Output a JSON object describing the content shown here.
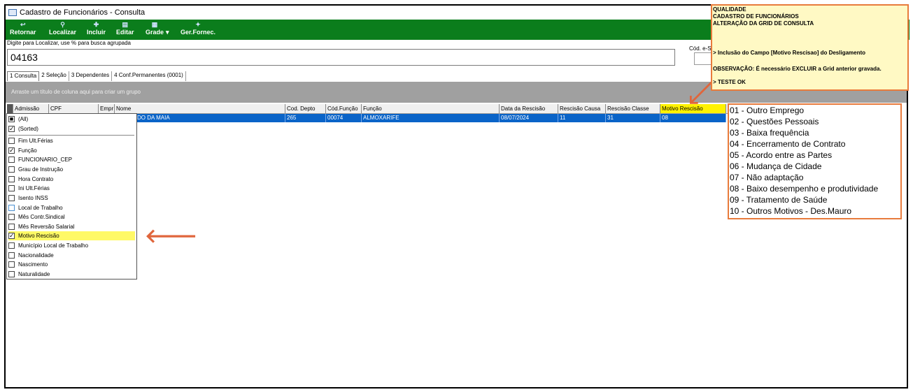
{
  "window": {
    "title": "Cadastro de Funcionários - Consulta"
  },
  "toolbar": {
    "buttons": [
      {
        "label": "Retornar",
        "icon": "return-icon"
      },
      {
        "label": "Localizar",
        "icon": "search-icon"
      },
      {
        "label": "Incluir",
        "icon": "add-icon"
      },
      {
        "label": "Editar",
        "icon": "edit-icon"
      },
      {
        "label": "Grade",
        "icon": "grid-icon"
      },
      {
        "label": "Ger.Fornec.",
        "icon": "supplier-icon"
      }
    ],
    "bg_color": "#0b7d1c"
  },
  "search": {
    "label": "Digite para Localizar, use % para busca agrupada",
    "value": "04163",
    "cod_label": "Cód. e-S"
  },
  "tabs": [
    "1 Consulta",
    "2 Seleção",
    "3 Dependentes",
    "4 Conf.Permanentes (0001)"
  ],
  "group_hint": "Arraste um título de coluna aqui para criar um grupo",
  "grid": {
    "columns": [
      "Admissão",
      "CPF",
      "Empr",
      "Nome",
      "Cod. Depto",
      "Cód.Função",
      "Função",
      "Data da Rescisão",
      "Rescisão Causa",
      "Rescisão Classe",
      "Motivo Rescisão"
    ],
    "row": {
      "nome": "DO DA MAIA",
      "cod_depto": "265",
      "cod_funcao": "00074",
      "funcao": "ALMOXARIFE",
      "data_rescisao": "08/07/2024",
      "rescisao_causa": "11",
      "rescisao_classe": "31",
      "motivo_rescisao": "08"
    }
  },
  "column_chooser": {
    "items": [
      {
        "label": "(All)",
        "state": "partial"
      },
      {
        "label": "(Sorted)",
        "state": "checked"
      },
      {
        "label": "Fim Ult.Férias",
        "state": "unchecked"
      },
      {
        "label": "Função",
        "state": "checked"
      },
      {
        "label": "FUNCIONARIO_CEP",
        "state": "unchecked"
      },
      {
        "label": "Grau de Instrução",
        "state": "unchecked"
      },
      {
        "label": "Hora Contrato",
        "state": "unchecked"
      },
      {
        "label": "Ini Ult.Férias",
        "state": "unchecked"
      },
      {
        "label": "Isento INSS",
        "state": "unchecked"
      },
      {
        "label": "Local de Trabalho",
        "state": "unchecked"
      },
      {
        "label": "Mês Contr.Sindical",
        "state": "unchecked"
      },
      {
        "label": "Mês Reversão Salarial",
        "state": "unchecked"
      },
      {
        "label": "Motivo Rescisão",
        "state": "checked",
        "highlighted": true
      },
      {
        "label": "Município Local de Trabalho",
        "state": "unchecked"
      },
      {
        "label": "Nacionalidade",
        "state": "unchecked"
      },
      {
        "label": "Nascimento",
        "state": "unchecked"
      },
      {
        "label": "Naturalidade",
        "state": "unchecked"
      }
    ]
  },
  "note": {
    "lines": [
      "QUALIDADE",
      "CADASTRO DE FUNCIONÁRIOS",
      "ALTERAÇÃO DA GRID DE CONSULTA",
      "> Inclusão do Campo [Motivo Rescisao] do Desligamento",
      "OBSERVAÇÃO: É necessário EXCLUIR a Grid anterior gravada.",
      "> TESTE OK"
    ]
  },
  "motivos": [
    "01 - Outro Emprego",
    "02 - Questões Pessoais",
    "03 - Baixa frequência",
    "04 - Encerramento de Contrato",
    "05 - Acordo entre as Partes",
    "06 - Mudança de Cidade",
    "07 - Não adaptação",
    "08 - Baixo desempenho e produtividade",
    "09 - Tratamento de Saúde",
    "10 - Outros Motivos - Des.Mauro"
  ],
  "colors": {
    "accent": "#e87b3c",
    "selection": "#0a64c8",
    "highlight": "#fff200"
  }
}
